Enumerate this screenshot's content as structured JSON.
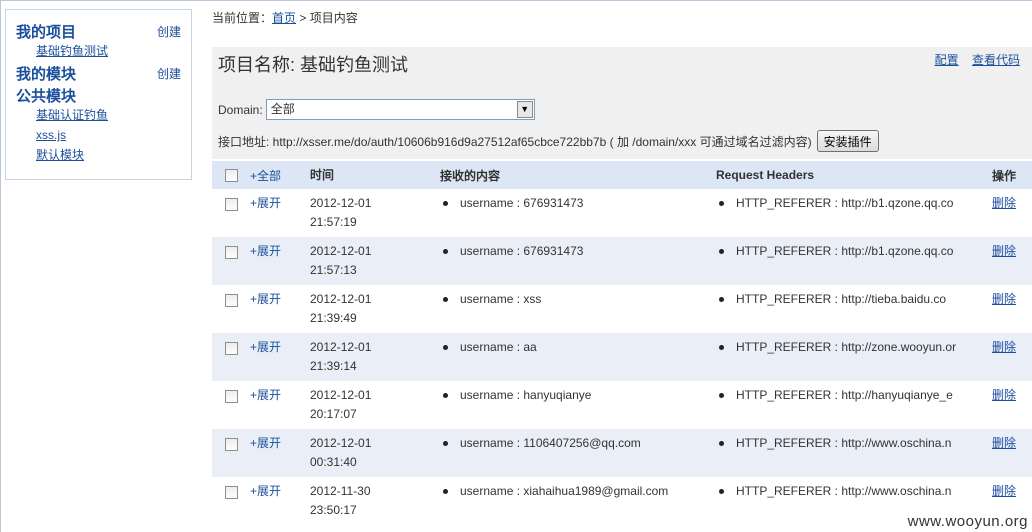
{
  "sidebar": {
    "my_projects": {
      "title": "我的项目",
      "create": "创建",
      "items": [
        "基础钓鱼测试"
      ]
    },
    "my_modules": {
      "title": "我的模块",
      "create": "创建"
    },
    "public_modules": {
      "title": "公共模块",
      "items": [
        "基础认证钓鱼",
        "xss.js",
        "默认模块"
      ]
    }
  },
  "breadcrumb": {
    "prefix": "当前位置：",
    "home": "首页",
    "sep": " > ",
    "current": "项目内容"
  },
  "project": {
    "title": "项目名称: 基础钓鱼测试",
    "config_link": "配置",
    "view_code_link": "查看代码",
    "domain_label": "Domain:",
    "domain_value": "全部",
    "api_text": "接口地址: http://xsser.me/do/auth/10606b916d9a27512af65cbce722bb7b ( 加 /domain/xxx 可通过域名过滤内容)",
    "install_button": "安装插件"
  },
  "table": {
    "headers": {
      "expand_all": "+全部",
      "time": "时间",
      "content": "接收的内容",
      "request_headers": "Request Headers",
      "action": "操作"
    },
    "rows": [
      {
        "expand": "+展开",
        "date": "2012-12-01",
        "time": "21:57:19",
        "content": "username : 676931473",
        "header": "HTTP_REFERER : http://b1.qzone.qq.co",
        "action": "删除"
      },
      {
        "expand": "+展开",
        "date": "2012-12-01",
        "time": "21:57:13",
        "content": "username : 676931473",
        "header": "HTTP_REFERER : http://b1.qzone.qq.co",
        "action": "删除"
      },
      {
        "expand": "+展开",
        "date": "2012-12-01",
        "time": "21:39:49",
        "content": "username : xss",
        "header": "HTTP_REFERER : http://tieba.baidu.co",
        "action": "删除"
      },
      {
        "expand": "+展开",
        "date": "2012-12-01",
        "time": "21:39:14",
        "content": "username : aa",
        "header": "HTTP_REFERER : http://zone.wooyun.or",
        "action": "删除"
      },
      {
        "expand": "+展开",
        "date": "2012-12-01",
        "time": "20:17:07",
        "content": "username : hanyuqianye",
        "header": "HTTP_REFERER : http://hanyuqianye_e",
        "action": "删除"
      },
      {
        "expand": "+展开",
        "date": "2012-12-01",
        "time": "00:31:40",
        "content": "username : 1106407256@qq.com",
        "header": "HTTP_REFERER : http://www.oschina.n",
        "action": "删除"
      },
      {
        "expand": "+展开",
        "date": "2012-11-30",
        "time": "23:50:17",
        "content": "username : xiahaihua1989@gmail.com",
        "header": "HTTP_REFERER : http://www.oschina.n",
        "action": "删除"
      }
    ]
  },
  "watermark": "www.wooyun.org"
}
